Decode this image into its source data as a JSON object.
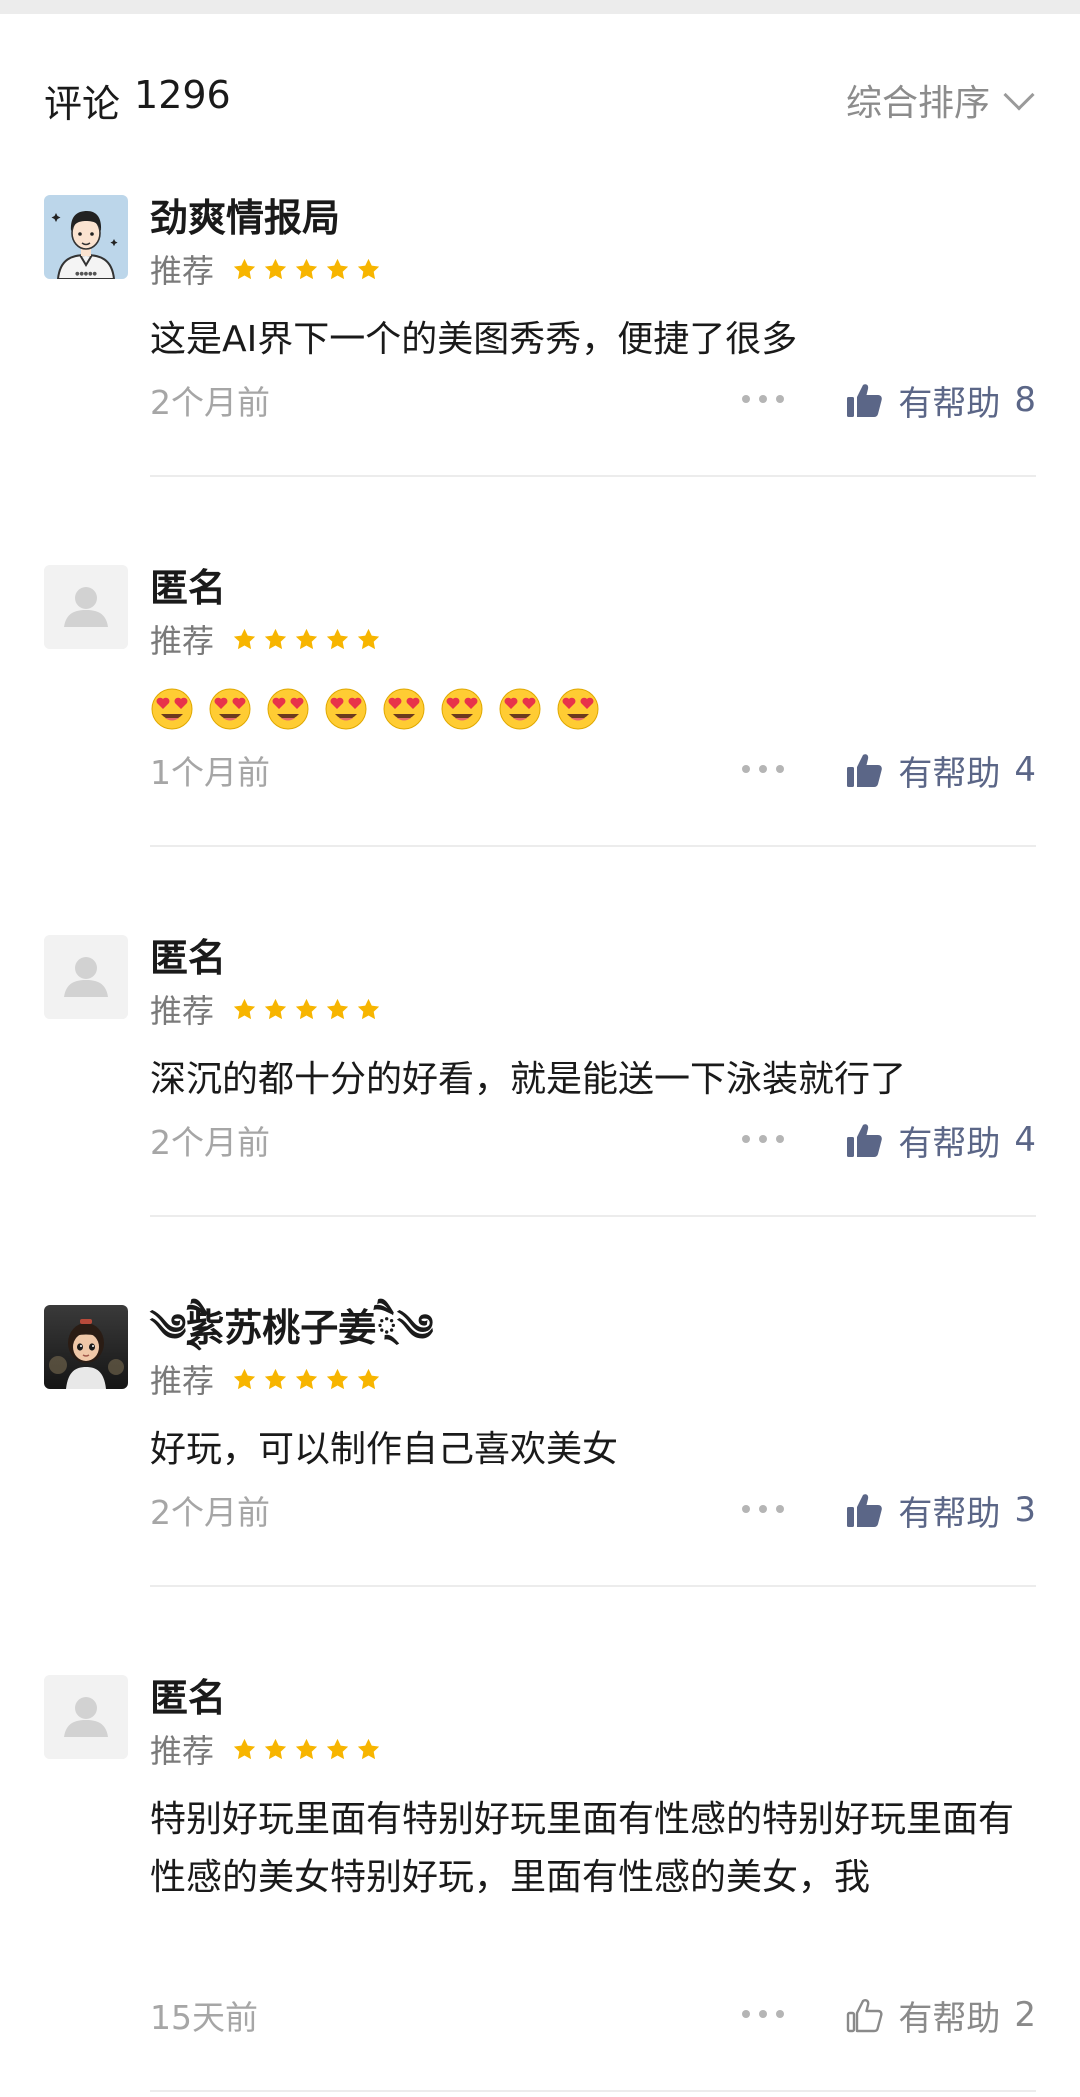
{
  "header": {
    "title": "评论",
    "count": "1296",
    "sort_label": "综合排序"
  },
  "icons": {
    "sort_chevron": "chevron-down-icon",
    "like": "thumbs-up-icon",
    "more": "more-dots-icon",
    "star": "star-icon"
  },
  "colors": {
    "star": "#f7b500",
    "helpful_active": "#5b6687",
    "helpful_inactive": "#8a8a8a",
    "time": "#a6a6a6"
  },
  "reviews": [
    {
      "author": "劲爽情报局",
      "tag": "推荐",
      "rating": 5,
      "content": "这是AI界下一个的美图秀秀，便捷了很多",
      "time": "2个月前",
      "helpful_label": "有帮助",
      "helpful_count": "8",
      "liked": true,
      "avatar": "cartoon-man"
    },
    {
      "author": "匿名",
      "tag": "推荐",
      "rating": 5,
      "content": "😍😍😍😍😍😍😍😍",
      "time": "1个月前",
      "helpful_label": "有帮助",
      "helpful_count": "4",
      "liked": true,
      "avatar": "default"
    },
    {
      "author": "匿名",
      "tag": "推荐",
      "rating": 5,
      "content": "深沉的都十分的好看，就是能送一下泳装就行了",
      "time": "2个月前",
      "helpful_label": "有帮助",
      "helpful_count": "4",
      "liked": true,
      "avatar": "default"
    },
    {
      "author": "༄྄ཻ紫苏桃子姜྄ཻ༄",
      "tag": "推荐",
      "rating": 5,
      "content": "好玩，可以制作自己喜欢美女",
      "time": "2个月前",
      "helpful_label": "有帮助",
      "helpful_count": "3",
      "liked": true,
      "avatar": "3d-girl"
    },
    {
      "author": "匿名",
      "tag": "推荐",
      "rating": 5,
      "content": "特别好玩里面有特别好玩里面有性感的特别好玩里面有性感的美女特别好玩，里面有性感的美女，我",
      "time": "15天前",
      "helpful_label": "有帮助",
      "helpful_count": "2",
      "liked": false,
      "avatar": "default"
    }
  ]
}
